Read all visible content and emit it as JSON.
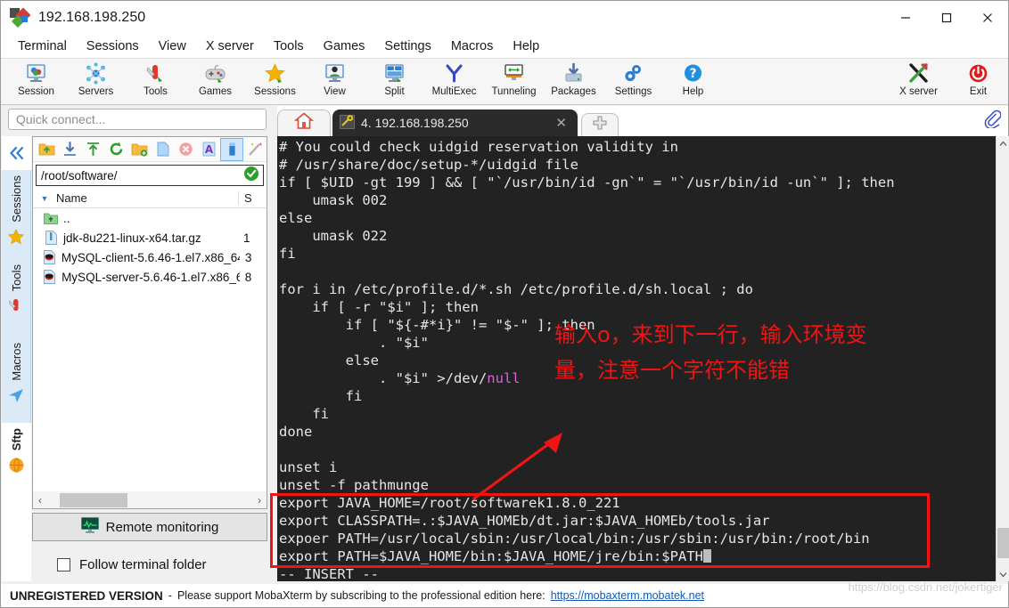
{
  "window": {
    "title": "192.168.198.250",
    "icon": "mobaxterm-icon",
    "minimize": "—",
    "maximize": "□",
    "close": "✕"
  },
  "menubar": {
    "items": [
      {
        "label": "Terminal"
      },
      {
        "label": "Sessions"
      },
      {
        "label": "View"
      },
      {
        "label": "X server"
      },
      {
        "label": "Tools"
      },
      {
        "label": "Games"
      },
      {
        "label": "Settings"
      },
      {
        "label": "Macros"
      },
      {
        "label": "Help"
      }
    ]
  },
  "toolbar": {
    "left_buttons": [
      {
        "label": "Session",
        "icon": "session-monitor-icon"
      },
      {
        "label": "Servers",
        "icon": "servers-nodes-icon"
      },
      {
        "label": "Tools",
        "icon": "tools-knife-icon"
      },
      {
        "label": "Games",
        "icon": "games-gamepad-icon"
      },
      {
        "label": "Sessions",
        "icon": "sessions-star-icon"
      },
      {
        "label": "View",
        "icon": "view-person-monitor-icon"
      },
      {
        "label": "Split",
        "icon": "split-panes-icon"
      },
      {
        "label": "MultiExec",
        "icon": "multiexec-fork-icon"
      },
      {
        "label": "Tunneling",
        "icon": "tunneling-arrows-icon"
      },
      {
        "label": "Packages",
        "icon": "packages-download-icon"
      },
      {
        "label": "Settings",
        "icon": "settings-gears-icon"
      },
      {
        "label": "Help",
        "icon": "help-question-icon"
      }
    ],
    "right_buttons": [
      {
        "label": "X server",
        "icon": "x-server-icon"
      },
      {
        "label": "Exit",
        "icon": "exit-power-icon"
      }
    ]
  },
  "quick_connect": {
    "placeholder": "Quick connect...",
    "value": ""
  },
  "sidebar": {
    "collapse_icon": "double-chevron-left-icon",
    "tabs": [
      {
        "label": "Sessions",
        "icon": "star-icon",
        "active": false
      },
      {
        "label": "Tools",
        "icon": "swiss-knife-icon",
        "active": false
      },
      {
        "label": "Macros",
        "icon": "paper-plane-icon",
        "active": false
      },
      {
        "label": "Sftp",
        "icon": "globe-icon",
        "active": true
      }
    ]
  },
  "sftp": {
    "toolbar_icons": [
      {
        "name": "go-up-folder-icon",
        "selected": false
      },
      {
        "name": "download-icon",
        "selected": false
      },
      {
        "name": "upload-icon",
        "selected": false
      },
      {
        "name": "refresh-icon",
        "selected": false
      },
      {
        "name": "new-folder-icon",
        "selected": false
      },
      {
        "name": "new-file-icon",
        "selected": false
      },
      {
        "name": "delete-icon",
        "selected": false
      },
      {
        "name": "text-mode-icon",
        "selected": false
      },
      {
        "name": "binary-mode-icon",
        "selected": true
      },
      {
        "name": "magic-wand-icon",
        "selected": false
      }
    ],
    "path": "/root/software/",
    "path_ok_icon": "green-check-icon",
    "columns": [
      "Name",
      "S"
    ],
    "rows": [
      {
        "icon": "parent-folder-icon",
        "name": "..",
        "size": ""
      },
      {
        "icon": "archive-file-icon",
        "name": "jdk-8u221-linux-x64.tar.gz",
        "size": "1"
      },
      {
        "icon": "rpm-file-icon",
        "name": "MySQL-client-5.6.46-1.el7.x86_64...",
        "size": "3"
      },
      {
        "icon": "rpm-file-icon",
        "name": "MySQL-server-5.6.46-1.el7.x86_6...",
        "size": "8"
      }
    ],
    "hscroll": {
      "left_arrow": "‹",
      "right_arrow": "›"
    },
    "remote_monitoring": {
      "label": "Remote monitoring",
      "icon": "monitor-graph-icon"
    },
    "follow_terminal_folder": {
      "label": "Follow terminal folder",
      "checked": false
    }
  },
  "tabbar": {
    "home_tab": {
      "icon": "home-icon"
    },
    "terminal_tab": {
      "icon": "ssh-key-icon",
      "label": "4. 192.168.198.250",
      "close": "✕"
    },
    "new_tab": {
      "icon": "plus-icon"
    },
    "clipboard_button": {
      "icon": "paperclip-icon"
    }
  },
  "terminal": {
    "lines": [
      "# You could check uidgid reservation validity in",
      "# /usr/share/doc/setup-*/uidgid file",
      "if [ $UID -gt 199 ] && [ \"`/usr/bin/id -gn`\" = \"`/usr/bin/id -un`\" ]; then",
      "    umask 002",
      "else",
      "    umask 022",
      "fi",
      "",
      "for i in /etc/profile.d/*.sh /etc/profile.d/sh.local ; do",
      "    if [ -r \"$i\" ]; then",
      "        if [ \"${-#*i}\" != \"$-\" ]; then",
      "            . \"$i\"",
      "        else",
      "            . \"$i\" >/dev/",
      "        fi",
      "    fi",
      "done",
      "",
      "unset i",
      "unset -f pathmunge",
      "export JAVA_HOME=/root/softwarek1.8.0_221",
      "export CLASSPATH=.:$JAVA_HOMEb/dt.jar:$JAVA_HOMEb/tools.jar",
      "expoer PATH=/usr/local/sbin:/usr/local/bin:/usr/sbin:/usr/bin:/root/bin",
      "export PATH=$JAVA_HOME/bin:$JAVA_HOME/jre/bin:$PATH"
    ],
    "null_token": "null",
    "status_line": "-- INSERT --",
    "cursor": "block-cursor"
  },
  "annotations": {
    "note_line1": "输入o，来到下一行，输入环境变",
    "note_line2": "量，注意一个字符不能错",
    "arrow_icon": "red-arrow-icon",
    "highlight_box": "red-rectangle-highlight",
    "color": "#f01414"
  },
  "statusbar": {
    "badge": "UNREGISTERED VERSION",
    "separator": "-",
    "message": "Please support MobaXterm by subscribing to the professional edition here:",
    "link": "https://mobaxterm.mobatek.net"
  },
  "watermark": {
    "text": "https://blog.csdn.net/jokertiger"
  },
  "colors": {
    "accent_blue": "#2f7fd1",
    "terminal_bg": "#222222",
    "terminal_fg": "#e6e6e6",
    "annotation_red": "#f01414",
    "link_blue": "#1159b5"
  }
}
